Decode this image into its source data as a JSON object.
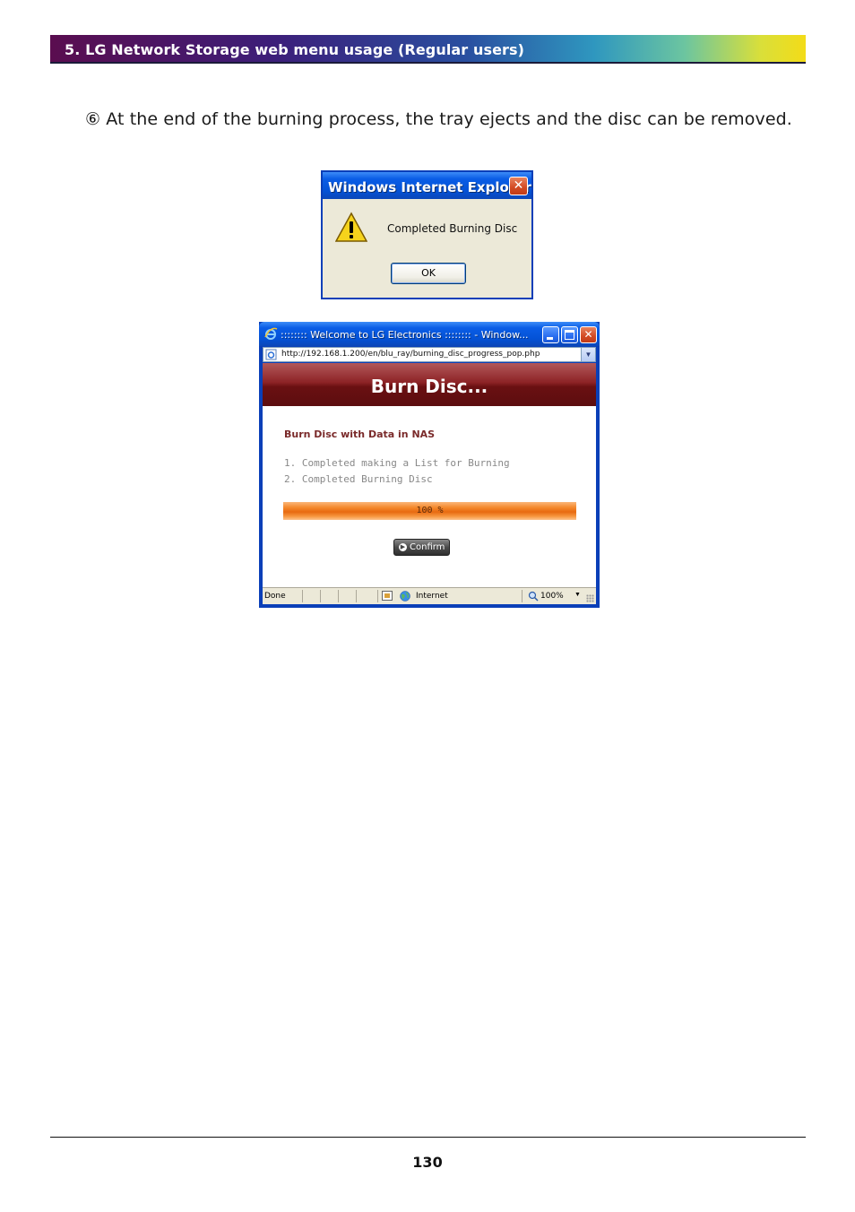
{
  "header": {
    "title": "5. LG Network Storage web menu usage (Regular users)"
  },
  "step": {
    "text": "⑥ At the end of the burning process, the tray ejects and the disc can be removed."
  },
  "alert_dialog": {
    "title": "Windows Internet Explorer",
    "close_glyph": "✕",
    "message": "Completed Burning Disc",
    "ok_label": "OK"
  },
  "ie_window": {
    "title": ":::::::: Welcome to LG Electronics :::::::: - Window...",
    "url": "http://192.168.1.200/en/blu_ray/burning_disc_progress_pop.php",
    "close_glyph": "✕",
    "dropdown_glyph": "▼",
    "content": {
      "heading": "Burn Disc...",
      "subtitle": "Burn Disc with Data in NAS",
      "steps": [
        "1. Completed making a List for Burning",
        "2. Completed Burning Disc"
      ],
      "progress": {
        "value": 100,
        "label": "100 %"
      },
      "confirm_label": "Confirm"
    },
    "status_bar": {
      "status": "Done",
      "zone": "Internet",
      "zoom": "100%",
      "zoom_arrow": "▼"
    }
  },
  "footer": {
    "page_number": "130"
  },
  "colors": {
    "burn_header": "#6a1012",
    "progress": "#f58a2e",
    "xp_titlebar": "#0452d6"
  }
}
